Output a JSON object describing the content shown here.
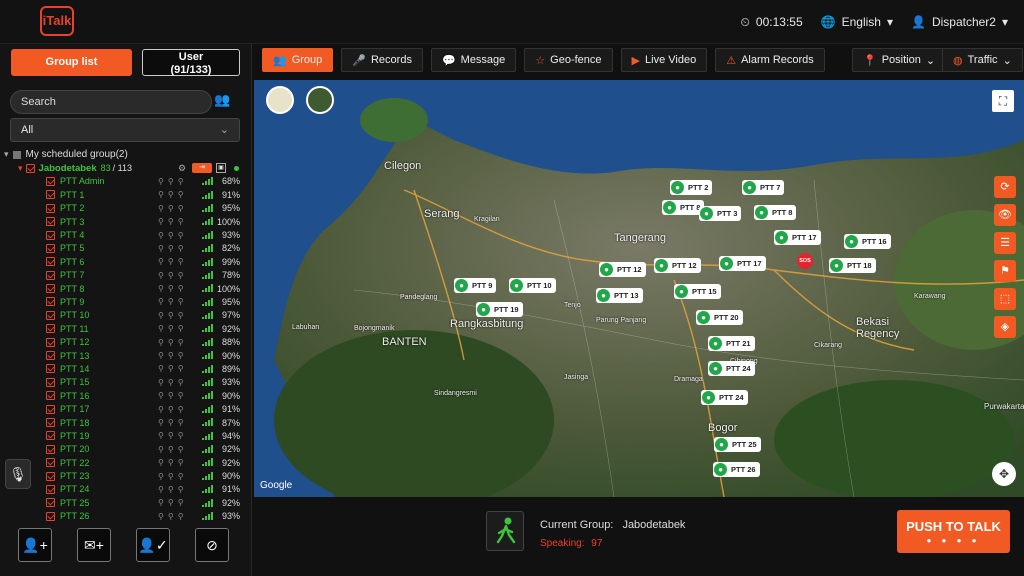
{
  "app": {
    "logo_text": "iTalk",
    "time": "00:13:55",
    "language": "English",
    "user": "Dispatcher2"
  },
  "sidebar": {
    "group_list_label": "Group list",
    "user_tab_label": "User",
    "user_tab_count": "(91/133)",
    "search_placeholder": "Search",
    "filter_value": "All",
    "scheduled_group": "My scheduled group(2)",
    "group_name": "Jabodetabek",
    "group_online": "83",
    "group_total": "/ 113",
    "members": [
      {
        "name": "PTT Admin",
        "pct": "68%"
      },
      {
        "name": "PTT 1",
        "pct": "91%"
      },
      {
        "name": "PTT 2",
        "pct": "95%"
      },
      {
        "name": "PTT 3",
        "pct": "100%"
      },
      {
        "name": "PTT 4",
        "pct": "93%"
      },
      {
        "name": "PTT 5",
        "pct": "82%"
      },
      {
        "name": "PTT 6",
        "pct": "99%"
      },
      {
        "name": "PTT 7",
        "pct": "78%"
      },
      {
        "name": "PTT 8",
        "pct": "100%"
      },
      {
        "name": "PTT 9",
        "pct": "95%"
      },
      {
        "name": "PTT 10",
        "pct": "97%"
      },
      {
        "name": "PTT 11",
        "pct": "92%"
      },
      {
        "name": "PTT 12",
        "pct": "88%"
      },
      {
        "name": "PTT 13",
        "pct": "90%"
      },
      {
        "name": "PTT 14",
        "pct": "89%"
      },
      {
        "name": "PTT 15",
        "pct": "93%"
      },
      {
        "name": "PTT 16",
        "pct": "90%"
      },
      {
        "name": "PTT 17",
        "pct": "91%"
      },
      {
        "name": "PTT 18",
        "pct": "87%"
      },
      {
        "name": "PTT 19",
        "pct": "94%"
      },
      {
        "name": "PTT 20",
        "pct": "92%"
      },
      {
        "name": "PTT 22",
        "pct": "92%"
      },
      {
        "name": "PTT 23",
        "pct": "90%"
      },
      {
        "name": "PTT 24",
        "pct": "91%"
      },
      {
        "name": "PTT 25",
        "pct": "92%"
      },
      {
        "name": "PTT 26",
        "pct": "93%"
      }
    ]
  },
  "tabs": [
    "Group",
    "Records",
    "Message",
    "Geo-fence",
    "Live Video",
    "Alarm Records"
  ],
  "tab_icons": [
    "group-icon",
    "mic-icon",
    "message-icon",
    "star-icon",
    "video-icon",
    "alarm-icon"
  ],
  "right_controls": {
    "position": "Position",
    "traffic": "Traffic"
  },
  "map": {
    "attribution": "Google",
    "pins": [
      "PTT 2",
      "PTT 7",
      "PTT 8",
      "PTT 3",
      "PTT 8",
      "PTT 17",
      "PTT 16",
      "PTT 12",
      "PTT 12",
      "PTT 17",
      "PTT 18",
      "PTT 9",
      "PTT 10",
      "PTT 13",
      "PTT 15",
      "PTT 19",
      "PTT 20",
      "PTT 21",
      "PTT 24",
      "PTT 24",
      "PTT 25",
      "PTT 26"
    ],
    "sos_label": "SOS",
    "places": [
      "Cilegon",
      "Serang",
      "Tangerang",
      "BANTEN",
      "Rangkasbitung",
      "Bekasi Regency",
      "Bogor",
      "Purwakarta",
      "Tenjo",
      "Jasinga",
      "Parung Panjang",
      "Dramaga",
      "Cibinong",
      "Cikarang",
      "Kragilan",
      "Bojongmanik",
      "Sindangresmi",
      "Karawang",
      "Pandeglang",
      "Labuhan"
    ]
  },
  "bottom": {
    "current_group_label": "Current Group:",
    "current_group_value": "Jabodetabek",
    "speaking_label": "Speaking:",
    "speaking_value": "97",
    "ptt_label": "PUSH TO TALK"
  },
  "colors": {
    "accent": "#f15a22",
    "online": "#3ec43e",
    "pin": "#22a64a"
  }
}
